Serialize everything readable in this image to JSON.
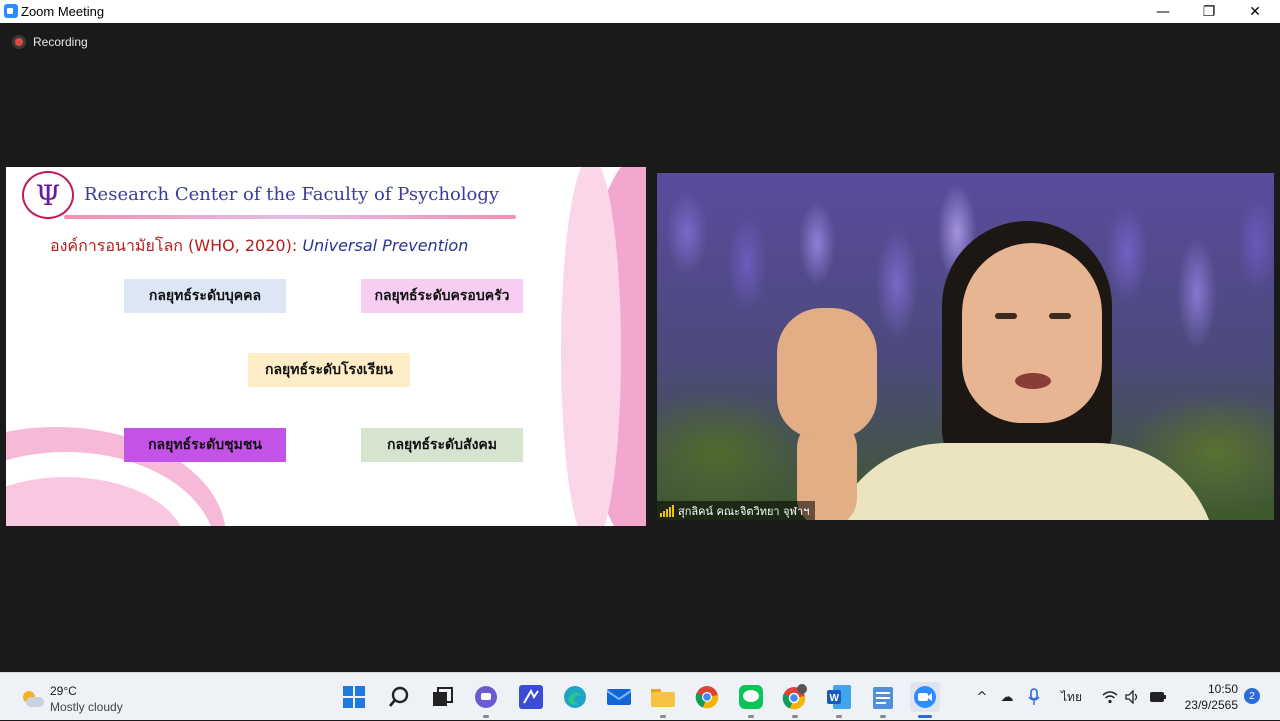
{
  "window": {
    "title": "Zoom Meeting",
    "minimize_glyph": "—",
    "maximize_glyph": "❐",
    "close_glyph": "✕"
  },
  "meeting": {
    "recording_label": "Recording",
    "shared_slide": {
      "logo_glyph": "Ψ",
      "header": "Research Center of the Faculty of Psychology",
      "subtitle_thai": "องค์การอนามัยโลก (WHO, 2020): ",
      "subtitle_english": "Universal Prevention",
      "strategies": [
        "กลยุทธ์ระดับบุคคล",
        "กลยุทธ์ระดับครอบครัว",
        "กลยุทธ์ระดับโรงเรียน",
        "กลยุทธ์ระดับชุมชน",
        "กลยุทธ์ระดับสังคม"
      ]
    },
    "participant": {
      "name": "สุกลิคน์ คณะจิตวิทยา จุฬาฯ"
    }
  },
  "taskbar": {
    "weather": {
      "temperature": "29°C",
      "condition": "Mostly cloudy"
    },
    "apps": [
      {
        "name": "start",
        "glyph": ""
      },
      {
        "name": "search",
        "glyph": "⚲"
      },
      {
        "name": "task-view",
        "glyph": "▣"
      },
      {
        "name": "chat",
        "glyph": "◍"
      },
      {
        "name": "whiteboard",
        "glyph": "✎"
      },
      {
        "name": "edge",
        "glyph": "◐"
      },
      {
        "name": "mail",
        "glyph": "✉"
      },
      {
        "name": "file-explorer",
        "glyph": "▬"
      },
      {
        "name": "chrome",
        "glyph": "●"
      },
      {
        "name": "line",
        "glyph": "LINE"
      },
      {
        "name": "chrome-profile",
        "glyph": "●"
      },
      {
        "name": "word",
        "glyph": "W"
      },
      {
        "name": "notepad",
        "glyph": "☰"
      },
      {
        "name": "zoom",
        "glyph": "■"
      }
    ],
    "tray": {
      "chevron": "^",
      "onedrive": "☁",
      "mic": "🎙",
      "language": "ไทย",
      "wifi": "◠",
      "volume": "🔈",
      "battery": "▭"
    },
    "time": "10:50",
    "date": "23/9/2565",
    "notification_count": "2"
  },
  "colors": {
    "accent_blue": "#2d8cff",
    "recording_red": "#e04a3a",
    "slide_pink": "#f3a7cf"
  }
}
